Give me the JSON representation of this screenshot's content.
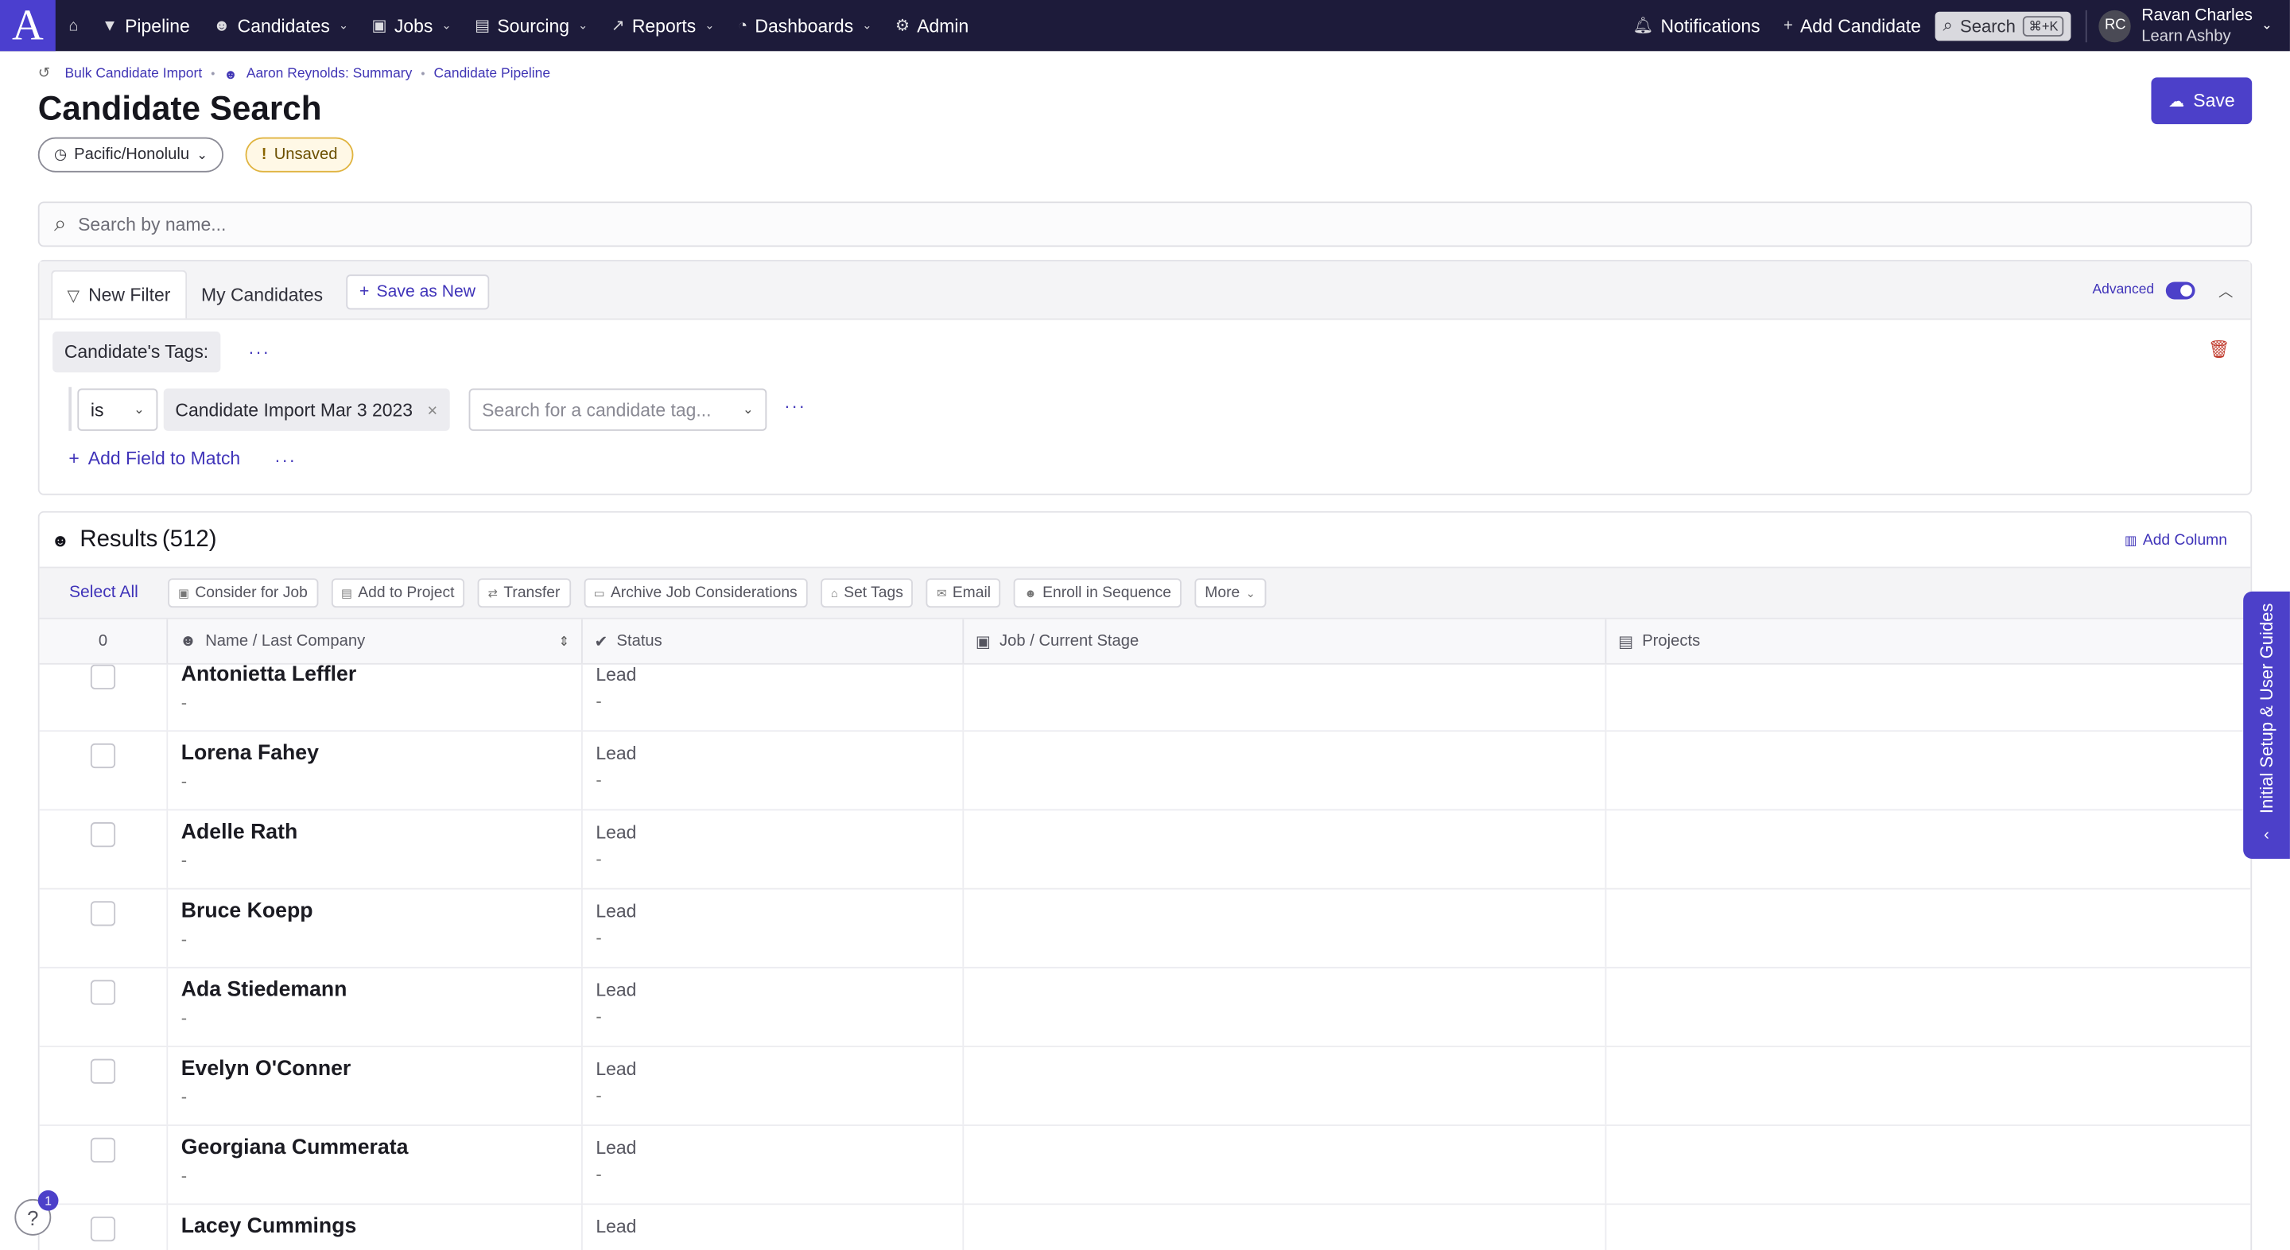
{
  "nav": {
    "logo": "A",
    "items": [
      {
        "label": "Pipeline",
        "icon": "filter-icon",
        "dropdown": false
      },
      {
        "label": "Candidates",
        "icon": "people-icon",
        "dropdown": true
      },
      {
        "label": "Jobs",
        "icon": "briefcase-icon",
        "dropdown": true
      },
      {
        "label": "Sourcing",
        "icon": "sourcing-icon",
        "dropdown": true
      },
      {
        "label": "Reports",
        "icon": "chart-icon",
        "dropdown": true
      },
      {
        "label": "Dashboards",
        "icon": "gauge-icon",
        "dropdown": true
      },
      {
        "label": "Admin",
        "icon": "gear-icon",
        "dropdown": false
      }
    ],
    "notifications": "Notifications",
    "add_candidate": "Add Candidate",
    "search": "Search",
    "shortcut": "⌘+K",
    "user_initials": "RC",
    "user_name": "Ravan Charles",
    "user_org": "Learn Ashby"
  },
  "breadcrumb": [
    "Bulk Candidate Import",
    "Aaron Reynolds: Summary",
    "Candidate Pipeline"
  ],
  "page": {
    "title": "Candidate Search",
    "timezone": "Pacific/Honolulu",
    "unsaved": "Unsaved",
    "save": "Save",
    "search_placeholder": "Search by name..."
  },
  "filter": {
    "tabs": [
      "New Filter",
      "My Candidates"
    ],
    "save_as_new": "Save as New",
    "advanced": "Advanced",
    "advanced_on": true,
    "field_label": "Candidate's Tags:",
    "operator": "is",
    "tag_value": "Candidate Import Mar 3 2023",
    "tag_search_placeholder": "Search for a candidate tag...",
    "add_field": "Add Field to Match"
  },
  "results": {
    "title": "Results",
    "count": "(512)",
    "add_column": "Add Column",
    "select_all": "Select All",
    "actions": [
      "Consider for Job",
      "Add to Project",
      "Transfer",
      "Archive Job Considerations",
      "Set Tags",
      "Email",
      "Enroll in Sequence",
      "More"
    ],
    "columns": {
      "selected": "0",
      "name": "Name / Last Company",
      "status": "Status",
      "job": "Job / Current Stage",
      "projects": "Projects"
    },
    "rows": [
      {
        "name": "Antonietta Leffler",
        "company": "-",
        "status": "Lead",
        "status_sub": "-"
      },
      {
        "name": "Lorena Fahey",
        "company": "-",
        "status": "Lead",
        "status_sub": "-"
      },
      {
        "name": "Adelle Rath",
        "company": "-",
        "status": "Lead",
        "status_sub": "-"
      },
      {
        "name": "Bruce Koepp",
        "company": "-",
        "status": "Lead",
        "status_sub": "-"
      },
      {
        "name": "Ada Stiedemann",
        "company": "-",
        "status": "Lead",
        "status_sub": "-"
      },
      {
        "name": "Evelyn O'Conner",
        "company": "-",
        "status": "Lead",
        "status_sub": "-"
      },
      {
        "name": "Georgiana Cummerata",
        "company": "-",
        "status": "Lead",
        "status_sub": "-"
      },
      {
        "name": "Lacey Cummings",
        "company": "-",
        "status": "Lead",
        "status_sub": "-"
      }
    ]
  },
  "side_tab": "Initial Setup & User Guides",
  "help_badge": "1",
  "colors": {
    "nav_bg": "#1d1b3a",
    "accent": "#4c40c9",
    "unsaved": "#e0b440",
    "delete": "#c0392b"
  }
}
